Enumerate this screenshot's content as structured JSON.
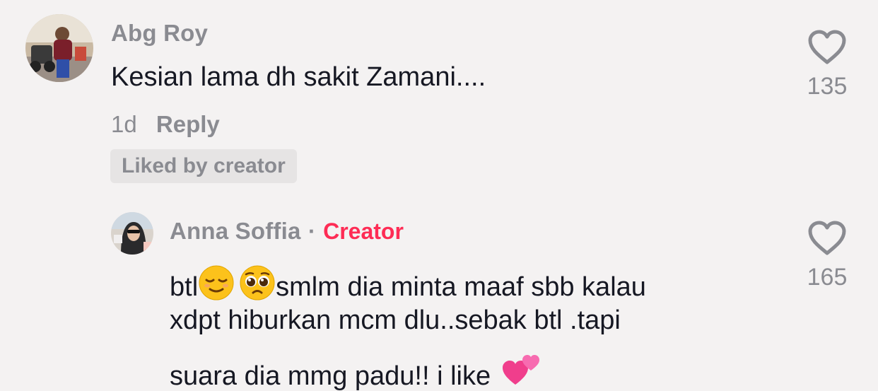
{
  "comments": [
    {
      "username": "Abg Roy",
      "text": "Kesian lama dh sakit Zamani....",
      "time": "1d",
      "reply_label": "Reply",
      "badge": "Liked by creator",
      "likes": "135",
      "heart_icon": "heart-outline-icon"
    }
  ],
  "reply": {
    "username": "Anna Soffia",
    "separator": "·",
    "creator_label": "Creator",
    "line1_prefix": "btl",
    "line1_suffix": "smlm dia minta maaf sbb kalau",
    "line2": "xdpt hiburkan mcm dlu..sebak btl .tapi",
    "line3": "suara dia mmg padu!! i like",
    "likes": "165",
    "emojis": [
      "relieved-face-icon",
      "pleading-face-icon",
      "two-hearts-icon"
    ]
  },
  "colors": {
    "background": "#f4f2f2",
    "creator": "#fe2c55",
    "muted": "#8a8b91",
    "text": "#161823"
  }
}
